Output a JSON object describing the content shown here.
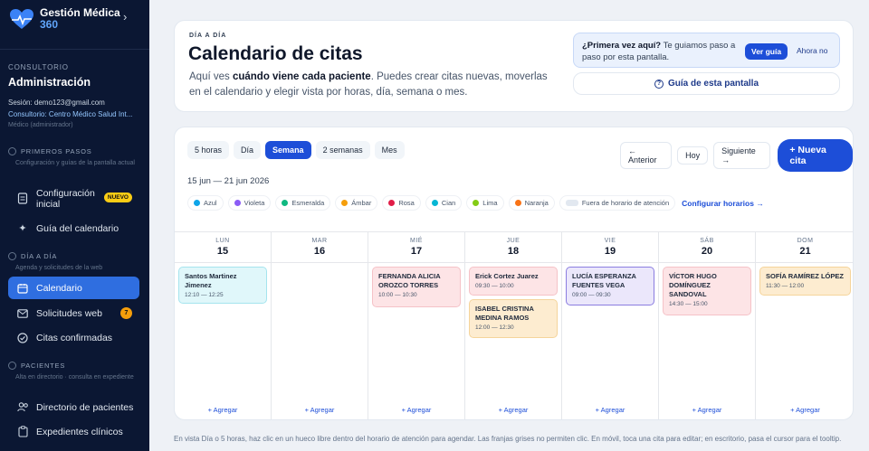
{
  "brand": {
    "title": "Gestión Médica",
    "subtitle": "360"
  },
  "sidebar": {
    "org_label": "CONSULTORIO",
    "org_name": "Administración",
    "session": "Sesión: demo123@gmail.com",
    "consultorio": "Consultorio: Centro Médico Salud Int...",
    "role": "Médico (administrador)",
    "sections": [
      {
        "title": "PRIMEROS PASOS",
        "desc": "Configuración y guías de la pantalla actual",
        "items": [
          {
            "label": "Configuración inicial",
            "badge": "NUEVO"
          },
          {
            "label": "Guía del calendario"
          }
        ]
      },
      {
        "title": "DÍA A DÍA",
        "desc": "Agenda y solicitudes de la web",
        "items": [
          {
            "label": "Calendario"
          },
          {
            "label": "Solicitudes web",
            "badge": "7"
          },
          {
            "label": "Citas confirmadas"
          }
        ]
      },
      {
        "title": "PACIENTES",
        "desc": "Alta en directorio · consulta en expediente",
        "items": [
          {
            "label": "Directorio de pacientes"
          },
          {
            "label": "Expedientes clínicos"
          }
        ]
      }
    ]
  },
  "header": {
    "eyebrow": "DÍA A DÍA",
    "title": "Calendario de citas",
    "desc_pre": "Aquí ves ",
    "desc_bold": "cuándo viene cada paciente",
    "desc_post": ". Puedes crear citas nuevas, moverlas en el calendario y elegir vista por horas, día, semana o mes.",
    "tip_bold": "¿Primera vez aquí?",
    "tip_rest": " Te guiamos paso a paso por esta pantalla.",
    "tip_primary": "Ver guía",
    "tip_secondary": "Ahora no",
    "guide_button": "Guía de esta pantalla"
  },
  "calendar": {
    "views": [
      "5 horas",
      "Día",
      "Semana",
      "2 semanas",
      "Mes"
    ],
    "active_view": "Semana",
    "nav": {
      "prev": "← Anterior",
      "today": "Hoy",
      "next": "Siguiente →",
      "new": "+ Nueva cita"
    },
    "range": "15 jun — 21 jun 2026",
    "legend": [
      {
        "label": "Azul",
        "color": "#0ea5e9"
      },
      {
        "label": "Violeta",
        "color": "#8b5cf6"
      },
      {
        "label": "Esmeralda",
        "color": "#10b981"
      },
      {
        "label": "Ámbar",
        "color": "#f59e0b"
      },
      {
        "label": "Rosa",
        "color": "#e11d48"
      },
      {
        "label": "Cian",
        "color": "#06b6d4"
      },
      {
        "label": "Lima",
        "color": "#84cc16"
      },
      {
        "label": "Naranja",
        "color": "#f97316"
      }
    ],
    "off_hours": "Fuera de horario de atención",
    "configure": "Configurar horarios →",
    "add_label": "+ Agregar",
    "days": [
      {
        "name": "LUN",
        "num": "15",
        "appointments": [
          {
            "name": "Santos Martinez Jimenez",
            "time": "12:10 — 12:25",
            "color": "cian"
          }
        ]
      },
      {
        "name": "MAR",
        "num": "16",
        "appointments": []
      },
      {
        "name": "MIÉ",
        "num": "17",
        "appointments": [
          {
            "name": "FERNANDA ALICIA OROZCO TORRES",
            "time": "10:00 — 10:30",
            "color": "rosa"
          }
        ]
      },
      {
        "name": "JUE",
        "num": "18",
        "appointments": [
          {
            "name": "Erick Cortez Juarez",
            "time": "09:30 — 10:00",
            "color": "rosa"
          },
          {
            "name": "ISABEL CRISTINA MEDINA RAMOS",
            "time": "12:00 — 12:30",
            "color": "ambar"
          }
        ]
      },
      {
        "name": "VIE",
        "num": "19",
        "appointments": [
          {
            "name": "LUCÍA ESPERANZA FUENTES VEGA",
            "time": "09:00 — 09:30",
            "color": "violeta"
          }
        ]
      },
      {
        "name": "SÁB",
        "num": "20",
        "appointments": [
          {
            "name": "VÍCTOR HUGO DOMÍNGUEZ SANDOVAL",
            "time": "14:30 — 15:00",
            "color": "rosa"
          }
        ]
      },
      {
        "name": "DOM",
        "num": "21",
        "appointments": [
          {
            "name": "SOFÍA RAMÍREZ LÓPEZ",
            "time": "11:30 — 12:00",
            "color": "ambar"
          }
        ]
      }
    ]
  },
  "appt_colors": {
    "cian": {
      "bg": "#e0f7fa",
      "border": "#a5e4ee"
    },
    "rosa": {
      "bg": "#fde4e6",
      "border": "#f5c2c7"
    },
    "ambar": {
      "bg": "#fdecd0",
      "border": "#f5d49b"
    },
    "violeta": {
      "bg": "#ebe7fb",
      "border": "#8b7de0"
    }
  },
  "footnote": "En vista Día o 5 horas, haz clic en un hueco libre dentro del horario de atención para agendar. Las franjas grises no permiten clic. En móvil, toca una cita para editar; en escritorio, pasa el cursor para el tooltip."
}
